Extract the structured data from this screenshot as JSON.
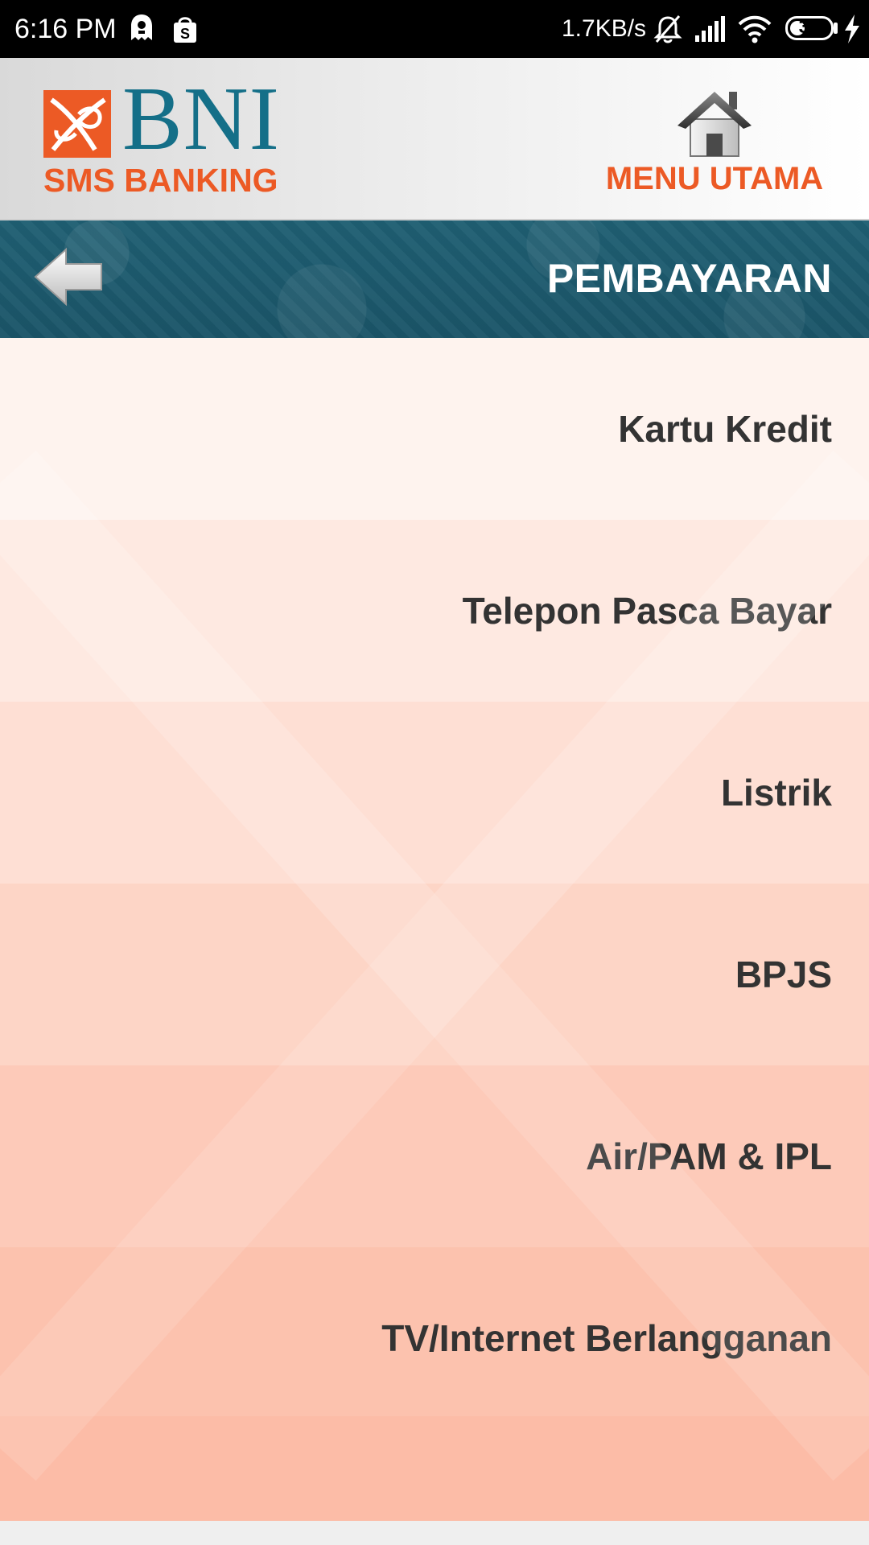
{
  "status_bar": {
    "time": "6:16 PM",
    "network_speed": "1.7KB/s",
    "battery_level": "38",
    "battery_fraction": 0.38,
    "icons": [
      "notification-app-icon",
      "shopping-bag-icon",
      "mute-icon",
      "signal-icon",
      "wifi-icon",
      "battery-icon",
      "charging-icon"
    ]
  },
  "header": {
    "logo_text": "BNI",
    "logo_subtitle": "SMS BANKING",
    "home_label": "MENU UTAMA",
    "brand_colors": {
      "orange": "#ec5a25",
      "teal": "#146f88"
    }
  },
  "title_bar": {
    "title": "PEMBAYARAN",
    "back_icon": "back-arrow-icon"
  },
  "menu": {
    "items": [
      {
        "label": "Kartu Kredit",
        "color": "#fef3ee"
      },
      {
        "label": "Telepon Pasca Bayar",
        "color": "#fee9e1"
      },
      {
        "label": "Listrik",
        "color": "#fedfd4"
      },
      {
        "label": "BPJS",
        "color": "#fdd5c6"
      },
      {
        "label": "Air/PAM & IPL",
        "color": "#fdcab9"
      },
      {
        "label": "TV/Internet Berlangganan",
        "color": "#fcc2ae"
      }
    ],
    "footer_color": "#fcbca7"
  }
}
